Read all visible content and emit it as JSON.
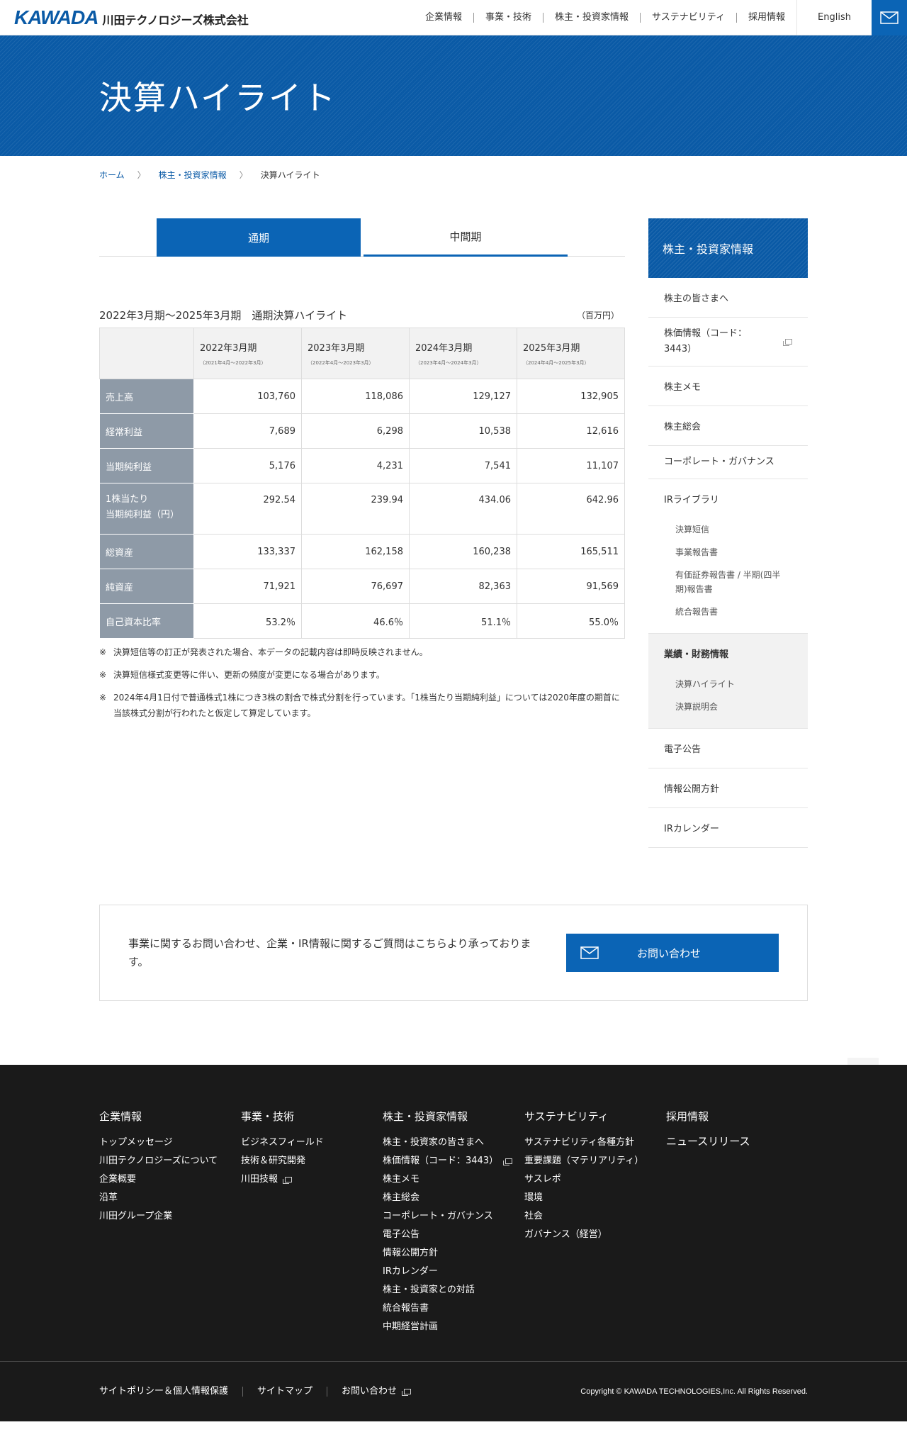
{
  "header": {
    "logo_mark": "KAWADA",
    "logo_jp": "川田テクノロジーズ株式会社",
    "nav": [
      "企業情報",
      "事業・技術",
      "株主・投資家情報",
      "サステナビリティ",
      "採用情報"
    ],
    "lang": "English",
    "mail_icon": "mail-icon"
  },
  "hero": {
    "title": "決算ハイライト"
  },
  "breadcrumb": {
    "home": "ホーム",
    "parent": "株主・投資家情報",
    "current": "決算ハイライト",
    "sep": "〉"
  },
  "tabs": {
    "annual": "通期",
    "interim": "中間期"
  },
  "table": {
    "title": "2022年3月期～2025年3月期　通期決算ハイライト",
    "unit": "（百万円）",
    "columns": [
      {
        "label": "2022年3月期",
        "sub": "（2021年4月～2022年3月）"
      },
      {
        "label": "2023年3月期",
        "sub": "（2022年4月～2023年3月）"
      },
      {
        "label": "2024年3月期",
        "sub": "（2023年4月～2024年3月）"
      },
      {
        "label": "2025年3月期",
        "sub": "（2024年4月～2025年3月）"
      }
    ],
    "rows": [
      {
        "label": "売上高",
        "label2": "",
        "values": [
          "103,760",
          "118,086",
          "129,127",
          "132,905"
        ]
      },
      {
        "label": "経常利益",
        "label2": "",
        "values": [
          "7,689",
          "6,298",
          "10,538",
          "12,616"
        ]
      },
      {
        "label": "当期純利益",
        "label2": "",
        "values": [
          "5,176",
          "4,231",
          "7,541",
          "11,107"
        ]
      },
      {
        "label": "1株当たり",
        "label2": "当期純利益（円）",
        "values": [
          "292.54",
          "239.94",
          "434.06",
          "642.96"
        ]
      },
      {
        "label": "総資産",
        "label2": "",
        "values": [
          "133,337",
          "162,158",
          "160,238",
          "165,511"
        ]
      },
      {
        "label": "純資産",
        "label2": "",
        "values": [
          "71,921",
          "76,697",
          "82,363",
          "91,569"
        ]
      },
      {
        "label": "自己資本比率",
        "label2": "",
        "values": [
          "53.2％",
          "46.6％",
          "51.1％",
          "55.0％"
        ]
      }
    ]
  },
  "notes": {
    "mark": "※",
    "items": [
      "決算短信等の訂正が発表された場合、本データの記載内容は即時反映されません。",
      "決算短信様式変更等に伴い、更新の頻度が変更になる場合があります。",
      "2024年4月1日付で普通株式1株につき3株の割合で株式分割を行っています。「1株当たり当期純利益」については2020年度の期首に当該株式分割が行われたと仮定して算定しています。"
    ]
  },
  "sidebar": {
    "title": "株主・投資家情報",
    "items": {
      "greeting": "株主の皆さまへ",
      "stock": "株価情報（コード：3443）",
      "memo": "株主メモ",
      "meeting": "株主総会",
      "governance": "コーポレート・ガバナンス",
      "library": "IRライブラリ",
      "library_subs": [
        "決算短信",
        "事業報告書",
        "有価証券報告書 / 半期(四半期)報告書",
        "統合報告書"
      ],
      "performance": "業績・財務情報",
      "performance_subs": [
        "決算ハイライト",
        "決算説明会"
      ],
      "notice": "電子公告",
      "disclosure": "情報公開方針",
      "calendar": "IRカレンダー"
    }
  },
  "contact": {
    "text": "事業に関するお問い合わせ、企業・IR情報に関するご質問はこちらより承っております。",
    "button": "お問い合わせ"
  },
  "footer": {
    "columns": [
      {
        "title": "企業情報",
        "links": [
          "トップメッセージ",
          "川田テクノロジーズについて",
          "企業概要",
          "沿革",
          "川田グループ企業"
        ]
      },
      {
        "title": "事業・技術",
        "links": [
          "ビジネスフィールド",
          "技術＆研究開発",
          "川田技報"
        ]
      },
      {
        "title": "株主・投資家情報",
        "links": [
          "株主・投資家の皆さまへ",
          "株価情報（コード：3443）",
          "株主メモ",
          "株主総会",
          "コーポレート・ガバナンス",
          "電子公告",
          "情報公開方針",
          "IRカレンダー",
          "株主・投資家との対話",
          "統合報告書",
          "中期経営計画"
        ]
      },
      {
        "title": "サステナビリティ",
        "links": [
          "サステナビリティ各種方針",
          "重要課題（マテリアリティ）",
          "サスレポ",
          "環境",
          "社会",
          "ガバナンス（経営）"
        ]
      },
      {
        "title": "採用情報",
        "links": [
          "ニュースリリース"
        ]
      }
    ],
    "bottom_links": [
      "サイトポリシー＆個人情報保護",
      "サイトマップ",
      "お問い合わせ"
    ],
    "copyright": "Copyright © KAWADA TECHNOLOGIES,Inc. All Rights Reserved."
  }
}
